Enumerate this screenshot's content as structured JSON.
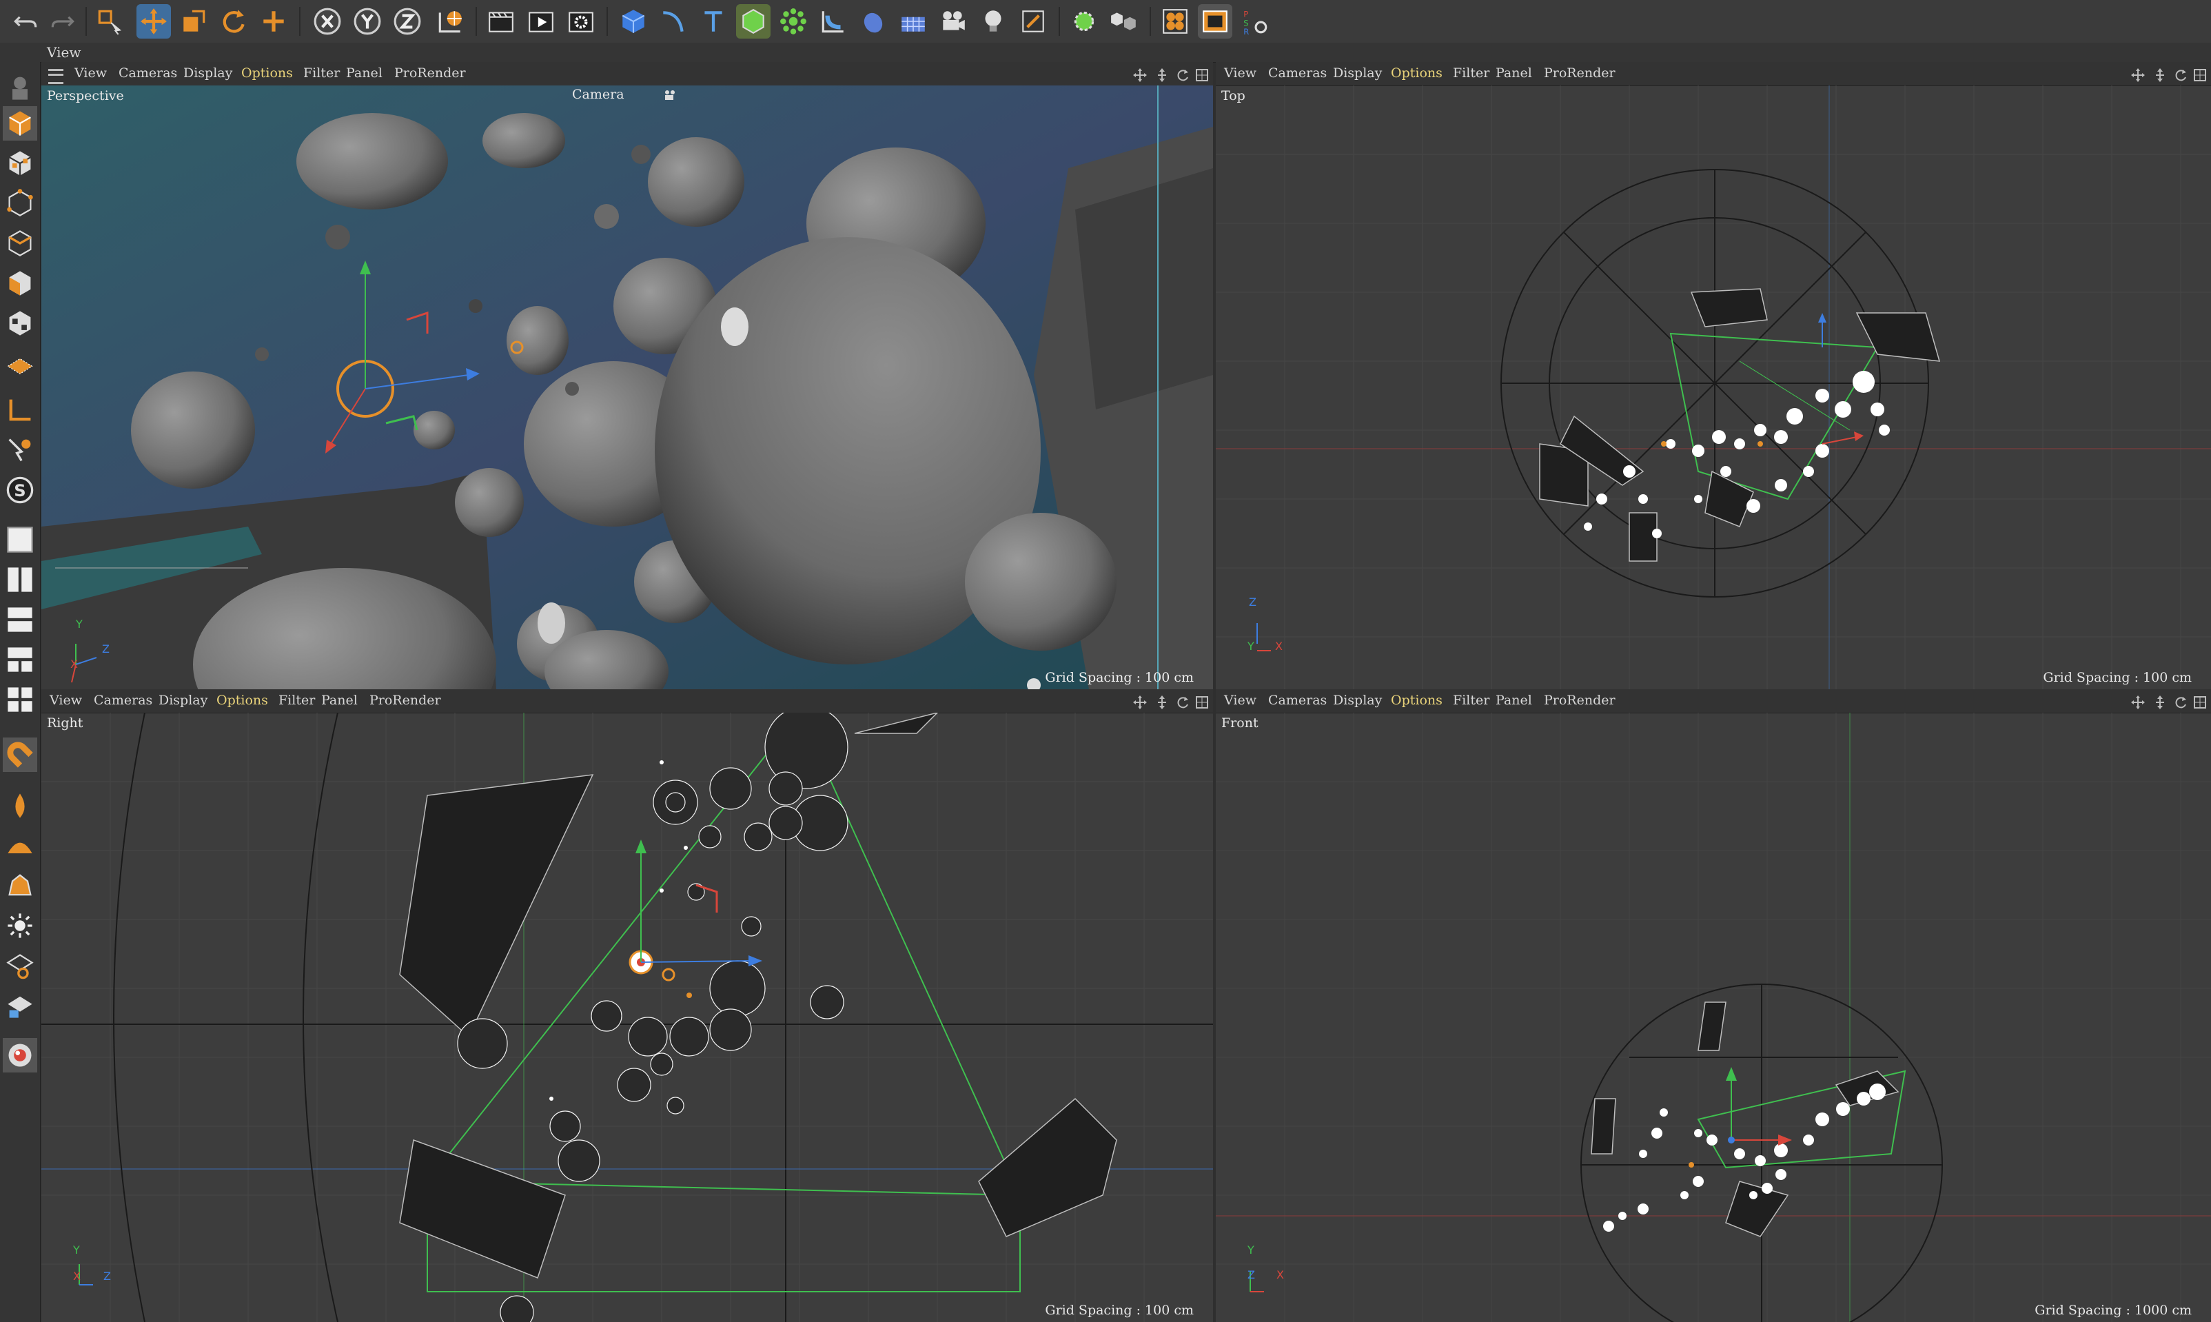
{
  "window": {
    "view_menu": "View"
  },
  "panes": [
    {
      "menu": [
        "View",
        "Cameras",
        "Display",
        "Options",
        "Filter",
        "Panel",
        "ProRender"
      ],
      "label": "Perspective",
      "camera_label": "Camera",
      "grid_spacing": "Grid Spacing : 100 cm",
      "axes": [
        "Y",
        "Z",
        "X"
      ]
    },
    {
      "menu": [
        "View",
        "Cameras",
        "Display",
        "Options",
        "Filter",
        "Panel",
        "ProRender"
      ],
      "label": "Top",
      "grid_spacing": "Grid Spacing : 100 cm",
      "axes": [
        "Z",
        "Y",
        "X"
      ]
    },
    {
      "menu": [
        "View",
        "Cameras",
        "Display",
        "Options",
        "Filter",
        "Panel",
        "ProRender"
      ],
      "label": "Right",
      "grid_spacing": "Grid Spacing : 100 cm",
      "axes": [
        "Y",
        "X",
        "Z"
      ]
    },
    {
      "menu": [
        "View",
        "Cameras",
        "Display",
        "Options",
        "Filter",
        "Panel",
        "ProRender"
      ],
      "label": "Front",
      "grid_spacing": "Grid Spacing : 1000 cm",
      "axes": [
        "Y",
        "Z",
        "X"
      ]
    }
  ],
  "toolbar_icons": [
    "undo-icon",
    "redo-icon",
    "live-selection-icon",
    "move-icon",
    "scale-icon",
    "rotate-icon",
    "add-icon",
    "x-axis-lock-icon",
    "y-axis-lock-icon",
    "z-axis-lock-icon",
    "world-coordinates-icon",
    "render-view-icon",
    "render-picture-viewer-icon",
    "render-settings-icon",
    "cube-icon",
    "spline-pen-icon",
    "text-icon",
    "subdivision-icon",
    "array-icon",
    "bend-deformer-icon",
    "environment-icon",
    "floor-icon",
    "camera-icon",
    "light-icon",
    "tag-icon",
    "xpresso-icon",
    "mograph-icon",
    "plugin-icon",
    "prorender-icon",
    "psr-reset-icon"
  ],
  "colors": {
    "accent_orange": "#e6902a",
    "options_yellow": "#e9d37a",
    "active_blue": "#5aa0e6",
    "axis_red": "#d8463b",
    "axis_green": "#3fbf4f",
    "axis_blue": "#3d7de0"
  }
}
